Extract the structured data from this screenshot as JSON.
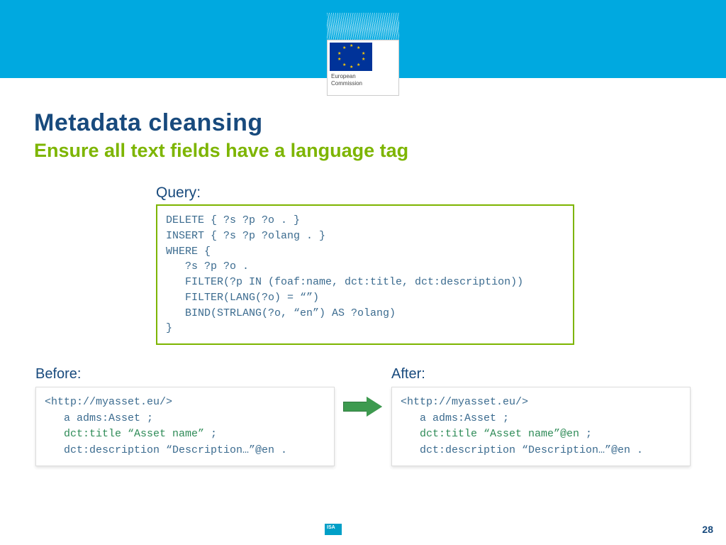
{
  "header": {
    "logo_caption_line1": "European",
    "logo_caption_line2": "Commission"
  },
  "title": "Metadata cleansing",
  "subtitle": "Ensure all text fields have a language tag",
  "query": {
    "label": "Query",
    "code": "DELETE { ?s ?p ?o . }\nINSERT { ?s ?p ?olang . }\nWHERE {\n   ?s ?p ?o .\n   FILTER(?p IN (foaf:name, dct:title, dct:description))\n   FILTER(LANG(?o) = “”)\n   BIND(STRLANG(?o, “en”) AS ?olang)\n}"
  },
  "before": {
    "label": "Before:",
    "line1": "<http://myasset.eu/>",
    "line2": "   a adms:Asset ;",
    "line3_hl": "   dct:title “Asset name”",
    "line3_tail": " ;",
    "line4": "   dct:description “Description…”@en ."
  },
  "after": {
    "label": "After:",
    "line1": "<http://myasset.eu/>",
    "line2": "   a adms:Asset ;",
    "line3_hl": "   dct:title “Asset name”@en",
    "line3_tail": " ;",
    "line4": "   dct:description “Description…”@en ."
  },
  "footer": {
    "isa": "ISA",
    "page": "28"
  }
}
